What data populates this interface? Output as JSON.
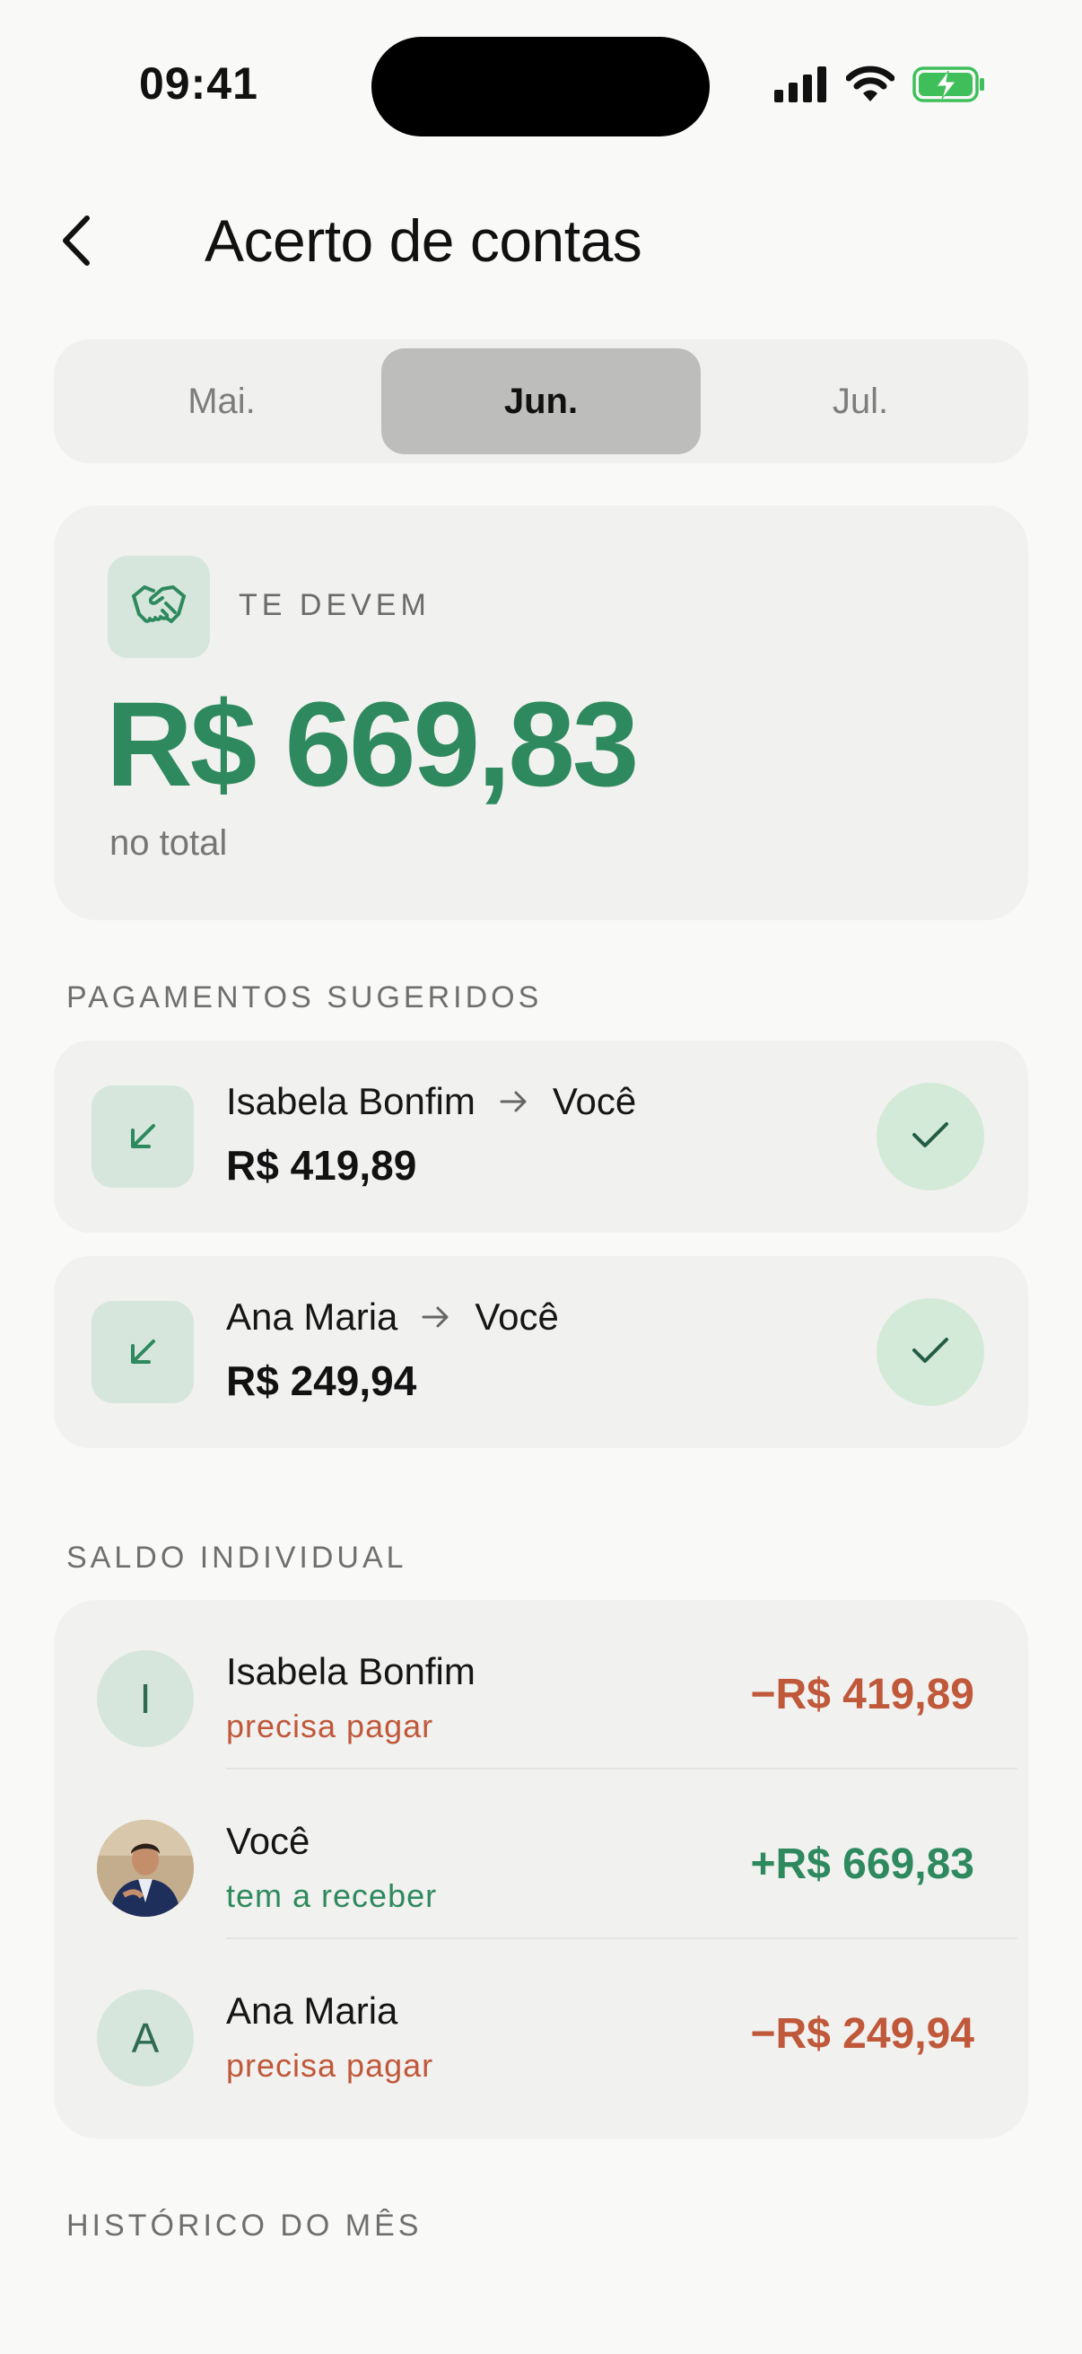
{
  "status_bar": {
    "time": "09:41",
    "icons": [
      "cellular-signal-icon",
      "wifi-icon",
      "battery-charging-icon"
    ]
  },
  "header": {
    "title": "Acerto de contas",
    "back_icon": "chevron-left-icon"
  },
  "month_tabs": [
    {
      "label": "Mai.",
      "selected": false
    },
    {
      "label": "Jun.",
      "selected": true
    },
    {
      "label": "Jul.",
      "selected": false
    }
  ],
  "summary": {
    "icon": "handshake-icon",
    "label": "TE DEVEM",
    "amount": "R$ 669,83",
    "subtitle": "no total"
  },
  "suggested_payments": {
    "title": "PAGAMENTOS SUGERIDOS",
    "items": [
      {
        "from": "Isabela Bonfim",
        "to": "Você",
        "amount": "R$ 419,89"
      },
      {
        "from": "Ana Maria",
        "to": "Você",
        "amount": "R$ 249,94"
      }
    ]
  },
  "individual_balance": {
    "title": "SALDO INDIVIDUAL",
    "items": [
      {
        "initial": "I",
        "name": "Isabela Bonfim",
        "status": "precisa pagar",
        "value": "−R$ 419,89",
        "sign": "negative"
      },
      {
        "initial": "",
        "name": "Você",
        "status": "tem a receber",
        "value": "+R$ 669,83",
        "sign": "positive",
        "avatar": "photo"
      },
      {
        "initial": "A",
        "name": "Ana Maria",
        "status": "precisa pagar",
        "value": "−R$ 249,94",
        "sign": "negative"
      }
    ]
  },
  "history": {
    "title": "HISTÓRICO DO MÊS"
  },
  "colors": {
    "positive": "#2e8a5e",
    "negative": "#c0583a",
    "accent_soft": "#d7e6dc"
  }
}
